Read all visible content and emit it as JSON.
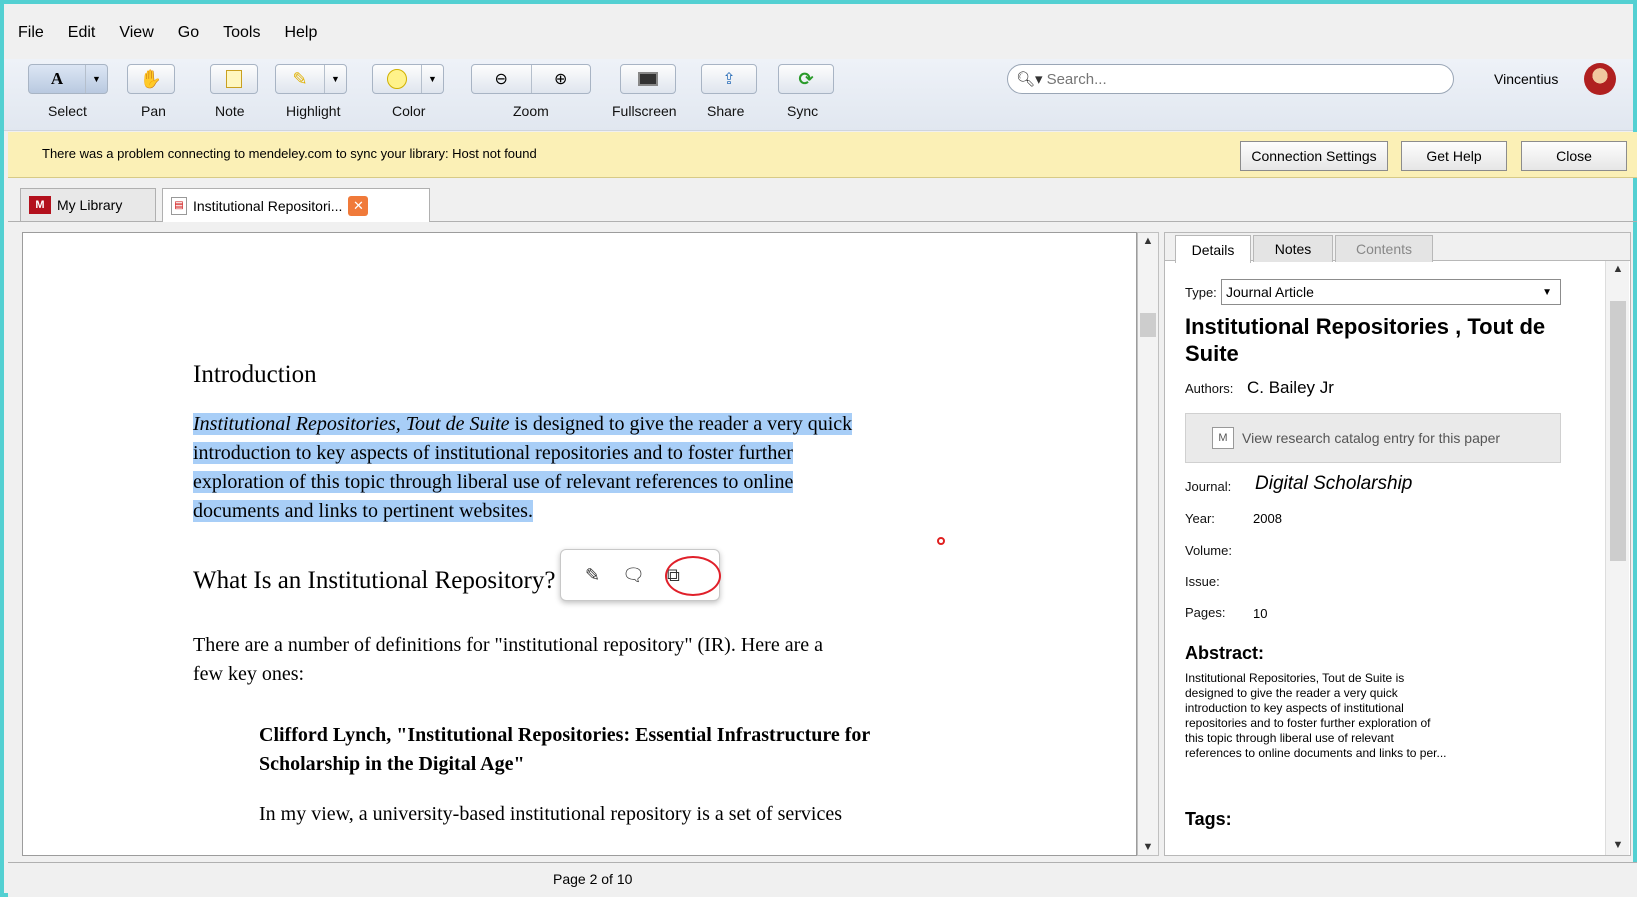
{
  "menu": [
    "File",
    "Edit",
    "View",
    "Go",
    "Tools",
    "Help"
  ],
  "toolbar": {
    "select": "Select",
    "pan": "Pan",
    "note": "Note",
    "highlight": "Highlight",
    "color": "Color",
    "zoom": "Zoom",
    "fullscreen": "Fullscreen",
    "share": "Share",
    "sync": "Sync",
    "select_icon_text": "A",
    "search_placeholder": "Search...",
    "user": "Vincentius"
  },
  "notification": {
    "message": "There was a problem connecting to mendeley.com to sync your library: Host not found",
    "buttons": {
      "settings": "Connection Settings",
      "help": "Get Help",
      "close": "Close"
    }
  },
  "tabs": {
    "library": "My Library",
    "document": "Institutional Repositori..."
  },
  "document": {
    "h1": "Introduction",
    "p1_italic": "Institutional Repositories, Tout de Suite",
    "p1_line1_rest": " is designed to give the reader a very quick",
    "p1_line2": "introduction to key aspects of institutional repositories and to foster further",
    "p1_line3": "exploration of this topic through liberal use of relevant references to online",
    "p1_line4": "documents and links to pertinent websites.",
    "h2": "What Is an Institutional Repository?",
    "p2_line1": "There are a number of definitions for \"institutional repository\" (IR).  Here are a",
    "p2_line2": "few key ones:",
    "bold_line1": "Clifford Lynch, \"Institutional Repositories: Essential Infrastructure for",
    "bold_line2": "Scholarship in the Digital Age\"",
    "p3_line1": "In my view, a university-based institutional repository is a set of services"
  },
  "details": {
    "tabs": [
      "Details",
      "Notes",
      "Contents"
    ],
    "type_label": "Type:",
    "type_value": "Journal Article",
    "title": "Institutional Repositories , Tout de Suite",
    "authors_label": "Authors:",
    "authors_value": "C. Bailey Jr",
    "catalog_button": "View research catalog entry for this paper",
    "journal_label": "Journal:",
    "journal_value": "Digital Scholarship",
    "year_label": "Year:",
    "year_value": "2008",
    "volume_label": "Volume:",
    "issue_label": "Issue:",
    "pages_label": "Pages:",
    "pages_value": "10",
    "abstract_heading": "Abstract:",
    "abstract_lines": [
      "Institutional Repositories, Tout de Suite is",
      "designed to give the reader a very quick",
      "introduction to key aspects of institutional",
      "repositories and to foster further exploration of",
      "this topic through liberal use of relevant",
      "references to online documents and links to per..."
    ],
    "tags_heading": "Tags:"
  },
  "status": {
    "page": "Page 2 of 10"
  },
  "colors": {
    "frame": "#53d0d2",
    "highlight": "#a8cef7",
    "notification": "#fbf0b6",
    "annotation_circle": "#e0202a"
  }
}
